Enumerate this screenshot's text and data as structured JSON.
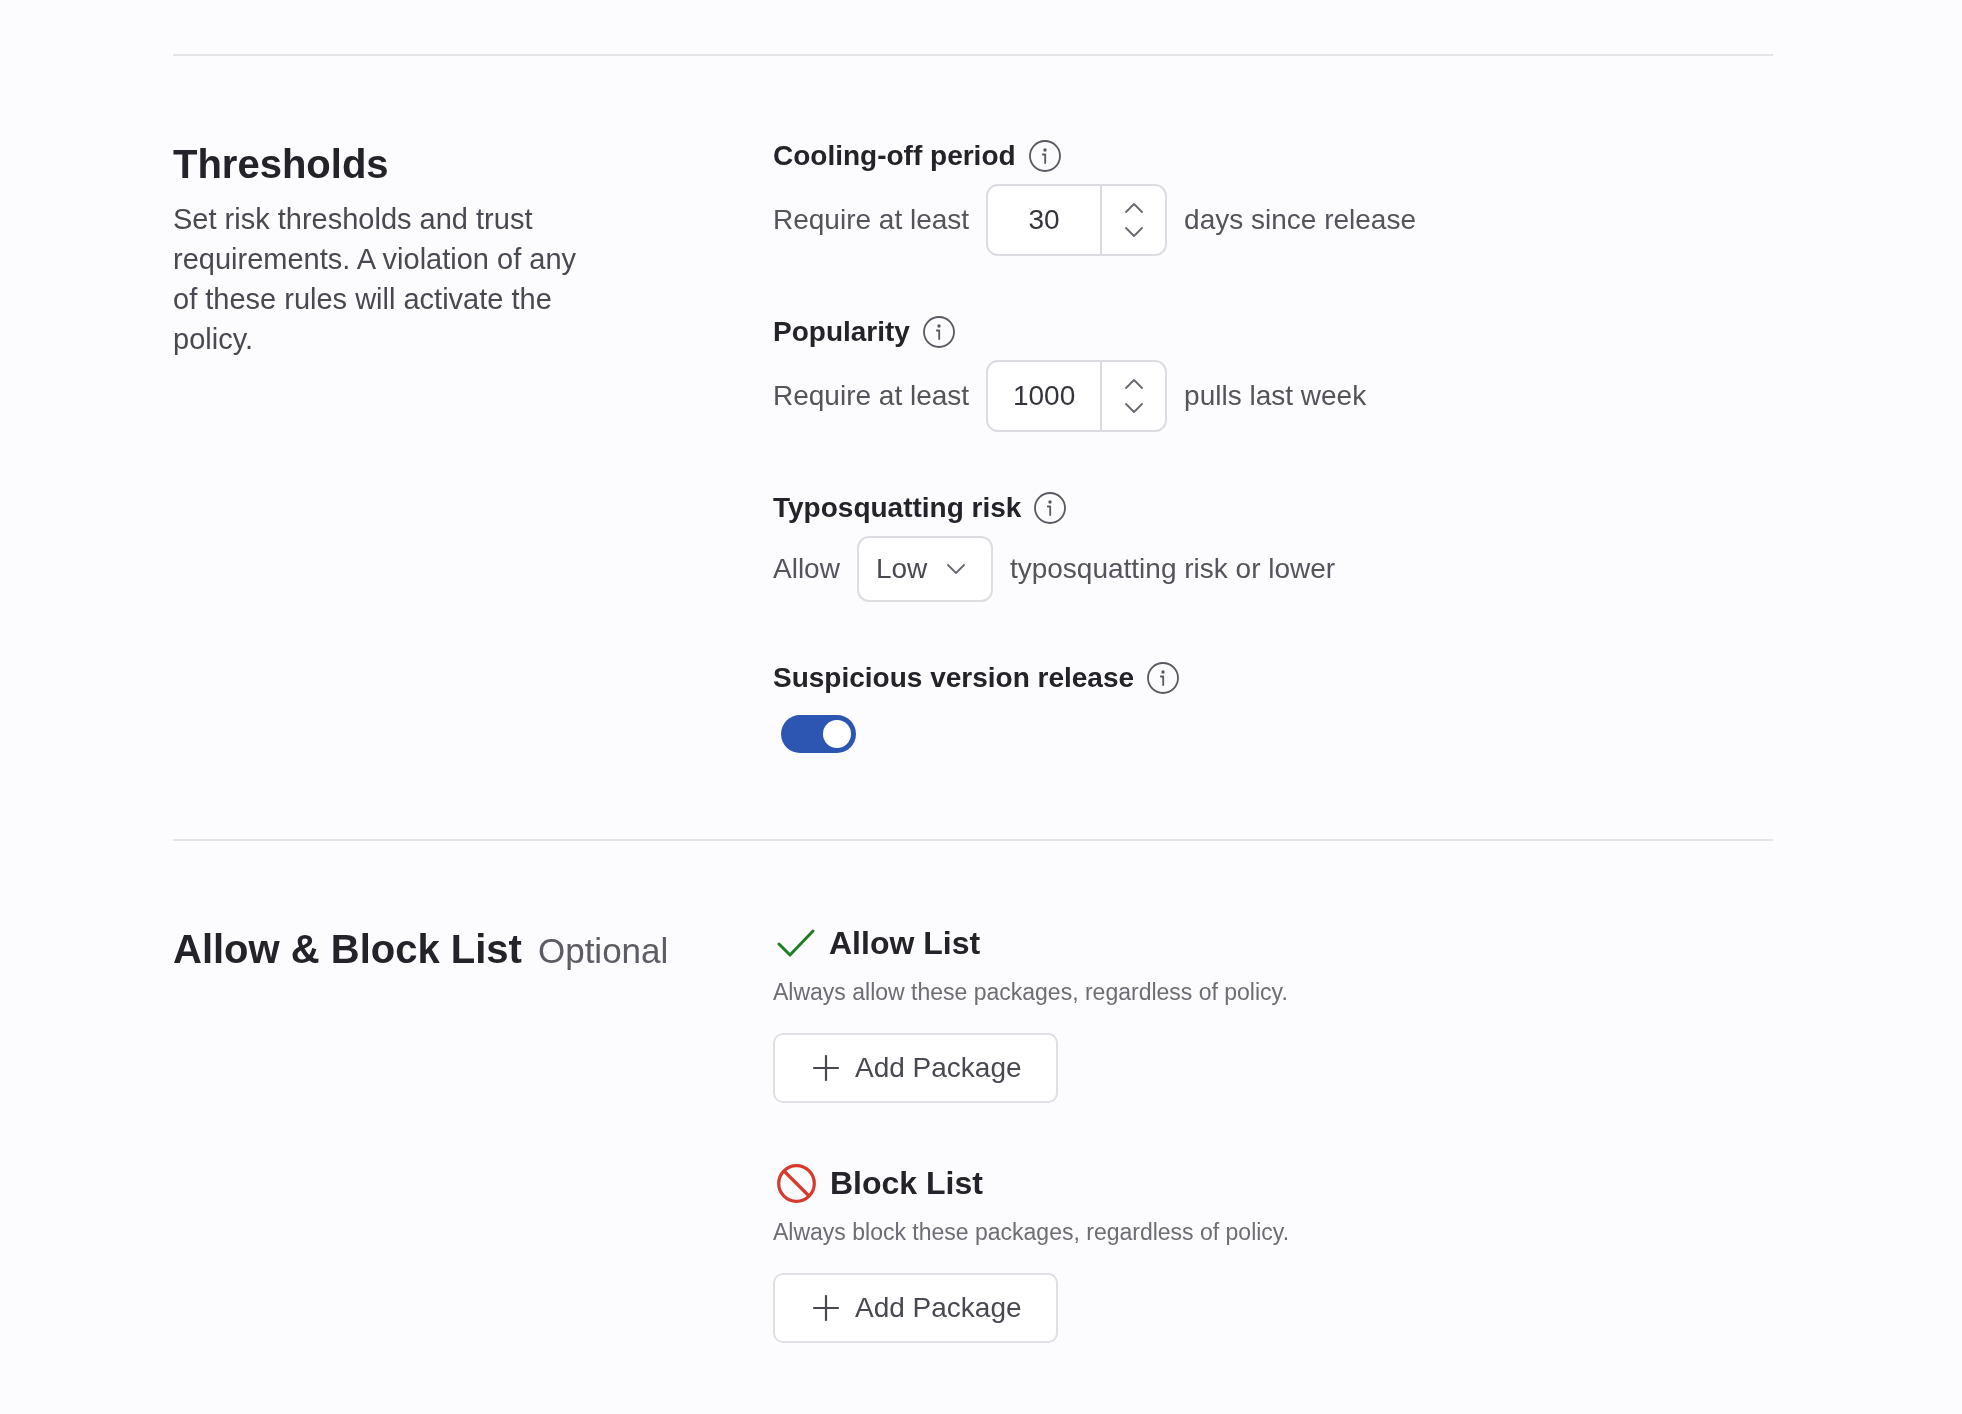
{
  "sections": [
    {
      "title": "Thresholds",
      "description": "Set risk thresholds and trust requirements. A violation of any of these rules will activate the policy.",
      "settings": [
        {
          "kind": "number",
          "label": "Cooling-off period",
          "prefix": "Require at least",
          "value": "30",
          "suffix": "days since release"
        },
        {
          "kind": "number",
          "label": "Popularity",
          "prefix": "Require at least",
          "value": "1000",
          "suffix": "pulls last week"
        },
        {
          "kind": "select",
          "label": "Typosquatting risk",
          "prefix": "Allow",
          "value": "Low",
          "suffix": "typosquatting risk or lower"
        },
        {
          "kind": "toggle",
          "label": "Suspicious version release",
          "on": true
        }
      ]
    },
    {
      "title": "Allow & Block List",
      "subtitle": "Optional",
      "lists": [
        {
          "kind": "allow",
          "title": "Allow List",
          "description": "Always allow these packages, regardless of policy.",
          "button": "Add Package"
        },
        {
          "kind": "block",
          "title": "Block List",
          "description": "Always block these packages, regardless of policy.",
          "button": "Add Package"
        }
      ]
    }
  ]
}
